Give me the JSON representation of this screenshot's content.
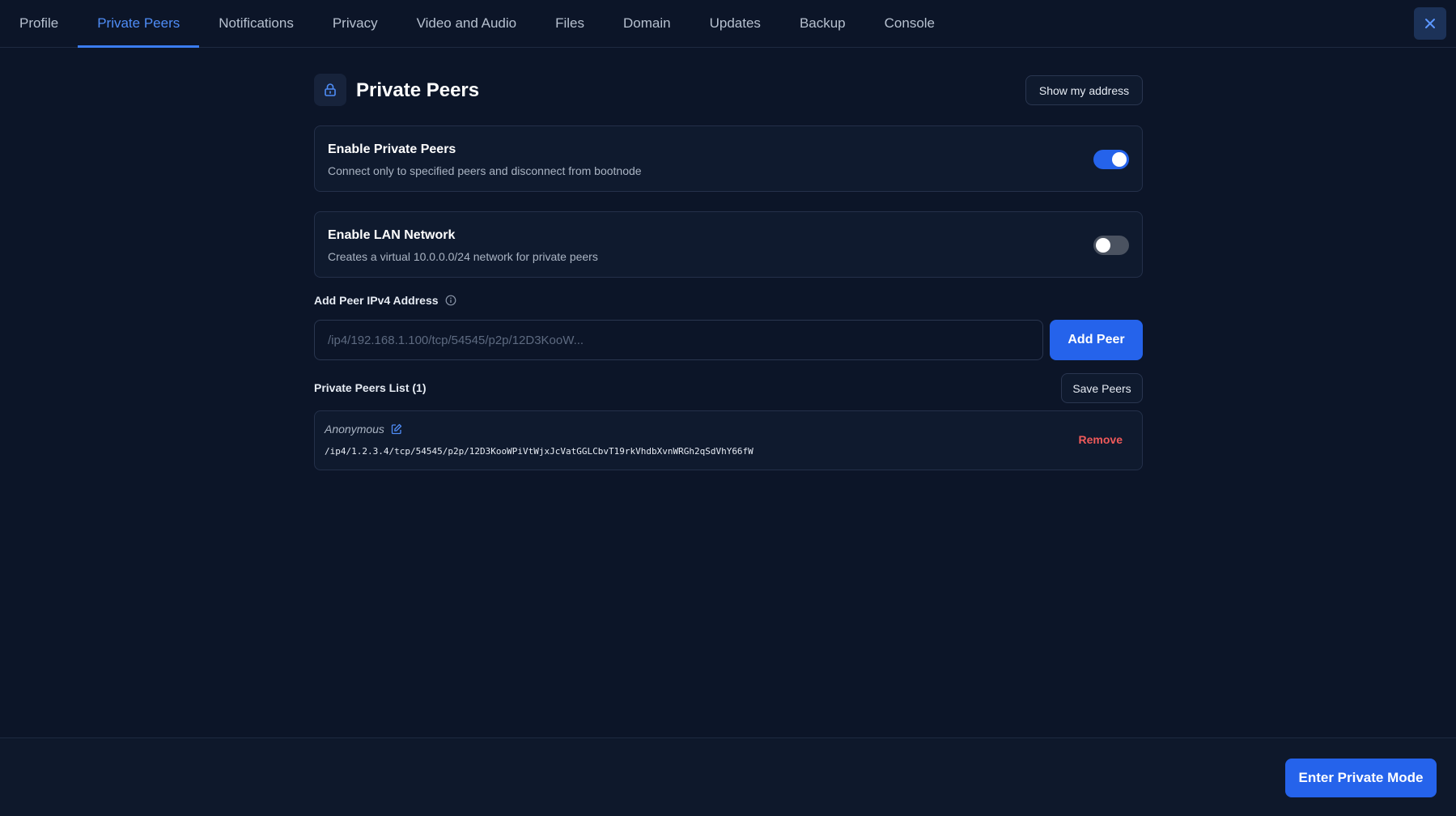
{
  "tabs": [
    {
      "label": "Profile"
    },
    {
      "label": "Private Peers",
      "active": true
    },
    {
      "label": "Notifications"
    },
    {
      "label": "Privacy"
    },
    {
      "label": "Video and Audio"
    },
    {
      "label": "Files"
    },
    {
      "label": "Domain"
    },
    {
      "label": "Updates"
    },
    {
      "label": "Backup"
    },
    {
      "label": "Console"
    }
  ],
  "header": {
    "title": "Private Peers",
    "show_address_label": "Show my address",
    "icon": "lock-icon"
  },
  "settings": {
    "private_peers": {
      "title": "Enable Private Peers",
      "description": "Connect only to specified peers and disconnect from bootnode",
      "enabled": true
    },
    "lan_network": {
      "title": "Enable LAN Network",
      "description": "Creates a virtual 10.0.0.0/24 network for private peers",
      "enabled": false
    }
  },
  "add_peer": {
    "label": "Add Peer IPv4 Address",
    "placeholder": "/ip4/192.168.1.100/tcp/54545/p2p/12D3KooW...",
    "value": "",
    "button_label": "Add Peer"
  },
  "peers_list": {
    "title": "Private Peers List (1)",
    "save_label": "Save Peers",
    "items": [
      {
        "name": "Anonymous",
        "address": "/ip4/1.2.3.4/tcp/54545/p2p/12D3KooWPiVtWjxJcVatGGLCbvT19rkVhdbXvnWRGh2qSdVhY66fW",
        "remove_label": "Remove"
      }
    ]
  },
  "footer": {
    "enter_private_label": "Enter Private Mode"
  },
  "colors": {
    "background": "#0c1528",
    "accent": "#2563eb",
    "active_tab": "#4f8df7",
    "danger": "#ef5a5a"
  }
}
